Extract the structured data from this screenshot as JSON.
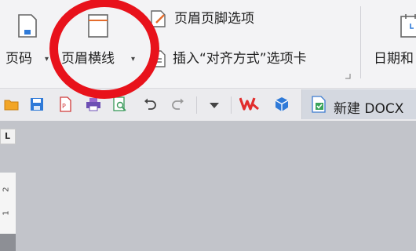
{
  "ribbon": {
    "page_number": {
      "label": "页码",
      "arrow": "▾",
      "icon": "page-number-icon"
    },
    "header_line": {
      "label": "页眉横线",
      "arrow": "▾",
      "icon": "header-line-icon"
    },
    "header_footer_options": {
      "label": "页眉页脚选项",
      "icon": "edit-page-icon"
    },
    "insert_align_tab": {
      "label": "插入“对齐方式”选项卡",
      "icon": "insert-doc-icon"
    },
    "date": {
      "label": "日期和",
      "icon": "calendar-icon"
    }
  },
  "document_tab": {
    "label": "新建 DOCX",
    "icon": "docx-file-icon"
  },
  "ruler": {
    "corner_mark": "L",
    "marks": [
      "2",
      "1"
    ]
  },
  "colors": {
    "annotation": "#e8121b",
    "wps_red": "#e12d2d",
    "accent_blue": "#2f7ad8"
  }
}
